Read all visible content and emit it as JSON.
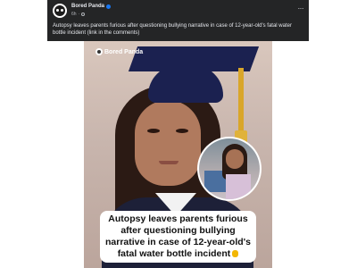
{
  "post": {
    "page_name": "Bored Panda",
    "time": "6h",
    "visibility_icon": "globe-icon",
    "verified_icon": "verified-badge-icon",
    "more_icon": "more-options-icon",
    "more_glyph": "···",
    "caption": "Autopsy leaves parents furious after questioning bullying narrative in case of 12-year-old's fatal water bottle incident (link in the comments)"
  },
  "image": {
    "watermark": "Bored Panda",
    "headline": "Autopsy leaves parents furious after questioning bullying narrative in case of 12-year-old's fatal water bottle incident",
    "emoji_icon": "pointing-down-emoji"
  },
  "colors": {
    "header_bg": "#242526",
    "text_primary": "#e4e6eb",
    "text_secondary": "#b0b3b8",
    "verified": "#1877f2"
  }
}
